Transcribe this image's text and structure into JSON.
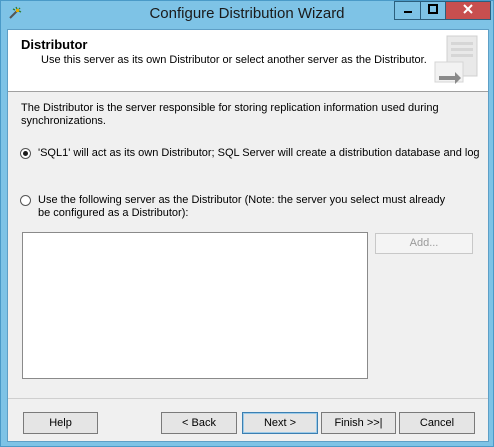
{
  "window": {
    "title": "Configure Distribution Wizard"
  },
  "header": {
    "title": "Distributor",
    "subtitle": "Use this server as its own Distributor or select another server as the Distributor."
  },
  "description": "The Distributor is the server responsible for storing replication information used during synchronizations.",
  "options": [
    {
      "label": "'SQL1' will act as its own Distributor; SQL Server will create a distribution database and log",
      "checked": true
    },
    {
      "label": "Use the following server as the Distributor (Note: the server you select must already be configured as a Distributor):",
      "checked": false
    }
  ],
  "add_button": {
    "label": "Add...",
    "enabled": false
  },
  "footer": {
    "help": "Help",
    "back": "< Back",
    "next": "Next >",
    "finish": "Finish >>|",
    "cancel": "Cancel"
  },
  "colors": {
    "titlebar": "#7ec3e6",
    "close": "#c74f4f",
    "client": "#f0f0f0"
  }
}
